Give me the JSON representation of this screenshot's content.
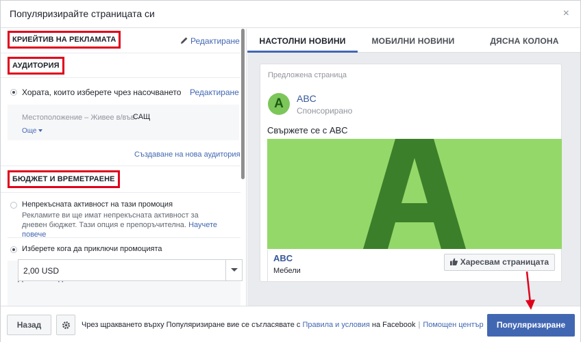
{
  "dialog": {
    "title": "Популяризирайте страницата си",
    "close_glyph": "×"
  },
  "left": {
    "creative": {
      "label": "КРИЕЙТИВ НА РЕКЛАМАТА",
      "edit": "Редактиране"
    },
    "audience": {
      "label": "АУДИТОРИЯ",
      "option_label": "Хората, които изберете чрез насочването",
      "option_edit": "Редактиране",
      "location_label": "Местоположение – Живее в/във:",
      "location_value": "САЩ",
      "more": "Още",
      "create_new": "Създаване на нова аудитория"
    },
    "budget": {
      "label": "БЮДЖЕТ И ВРЕМЕТРАЕНЕ",
      "continuous_title": "Непрекъсната активност на тази промоция",
      "continuous_desc": "Рекламите ви ще имат непрекъсната активност за дневен бюджет. Тази опция е препоръчителна.",
      "learn_more": "Научете повече",
      "choose_end": "Изберете кога да приключи промоцията",
      "daily_budget_label": "Дневен бюджет",
      "daily_budget_value": "2,00 USD"
    }
  },
  "preview": {
    "tabs": [
      "НАСТОЛНИ НОВИНИ",
      "МОБИЛНИ НОВИНИ",
      "ДЯСНА КОЛОНА"
    ],
    "active_tab": 0,
    "suggested": "Предложена страница",
    "avatar_letter": "A",
    "page_name": "ABC",
    "sponsored": "Спонсорирано",
    "message": "Свържете се с ABC",
    "image_letter": "A",
    "footer_name": "ABC",
    "footer_category": "Мебели",
    "like_button": "Харесвам страницата"
  },
  "bottom": {
    "back": "Назад",
    "terms_prefix": "Чрез щракването върху Популяризиране вие се съгласявате с",
    "terms_link": "Правила и условия",
    "terms_suffix": "на Facebook",
    "help_center": "Помощен център",
    "promote": "Популяризиране"
  },
  "colors": {
    "accent": "#4267b2",
    "annotation_red": "#e0001a",
    "image_bg": "#94d86a",
    "image_letter": "#3c7f2a"
  }
}
